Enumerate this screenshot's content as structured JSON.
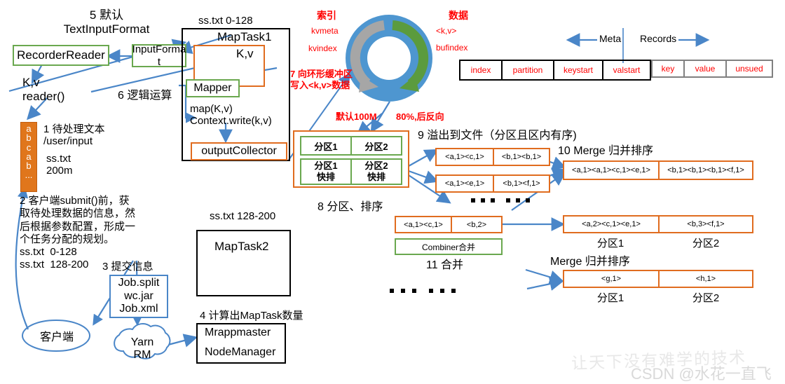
{
  "title": "MapReduce MapTask Shuffle Flow Diagram",
  "labels": {
    "step5": "5 默认\nTextInputFormat",
    "recorder_reader": "RecorderReader",
    "input_format": "InputForma\nt",
    "kv_reader": "K,v\nreader()",
    "step6": "6 逻辑运算",
    "step1": "1 待处理文本\n/user/input",
    "step1b": "ss.txt\n200m",
    "step2": "2 客户端submit()前，获\n取待处理数据的信息，然\n后根据参数配置，形成一\n个任务分配的规划。\nss.txt  0-128\nss.txt  128-200",
    "step3": "3 提交信息",
    "job_box": "Job.split\nwc.jar\nJob.xml",
    "client": "客户端",
    "yarn": "Yarn\nRM",
    "step4": "4 计算出MapTask数量",
    "mrappmaster": "Mrappmaster",
    "nodemanager": "NodeManager",
    "sstxt_0_128": "ss.txt 0-128",
    "maptask1": "MapTask1",
    "kv": "K,v",
    "mapper": "Mapper",
    "map_write": "map(K,v)\nContext.write(k,v)",
    "output_collector": "outputCollector",
    "sstxt_128_200": "ss.txt 128-200",
    "maptask2": "MapTask2",
    "index": "索引",
    "kvmeta": "kvmeta",
    "kvindex": "kvindex",
    "data": "数据",
    "kv_angle": "<k,v>",
    "bufindex": "bufindex",
    "step7": "7 向环形缓冲区\n写入<k,v>数据",
    "default100m": "默认100M",
    "percent80": "80%,后反向",
    "meta": "Meta",
    "records": "Records",
    "step8": "8 分区、排序",
    "step9": "9 溢出到文件（分区且区内有序)",
    "step10": "10 Merge 归并排序",
    "step11": "11 合并",
    "combiner": "Combiner合并",
    "merge_sort": "Merge 归并排序",
    "partition1": "分区1",
    "partition2": "分区2",
    "ellipsis": "• • •   • • •"
  },
  "partition_box": {
    "row1": [
      "分区1",
      "分区2"
    ],
    "row2": [
      "分区1\n快排",
      "分区2\n快排"
    ]
  },
  "meta_table": {
    "meta_cells": [
      "index",
      "partition",
      "keystart",
      "valstart"
    ],
    "record_cells": [
      "key",
      "value",
      "unsued"
    ]
  },
  "spill_files": [
    [
      "<a,1><c,1>",
      "<b,1><b,1>"
    ],
    [
      "<a,1><e,1>",
      "<b,1><f,1>"
    ]
  ],
  "merge_result": [
    "<a,1><a,1><c,1><e,1>",
    "<b,1><b,1><b,1><f,1>"
  ],
  "combine_input": [
    "<a,1><c,1>",
    "<b,2>"
  ],
  "combine_result": [
    "<a,2><c,1><e,1>",
    "<b,3><f,1>"
  ],
  "final_result": [
    "<g,1>",
    "<h,1>"
  ],
  "input_strip": [
    "a",
    "b",
    "c",
    "a",
    "b",
    "..."
  ],
  "watermark": {
    "slogan": "让天下没有难学的技术",
    "credit": "CSDN @水花一直飞"
  },
  "colors": {
    "green": "#6AA84F",
    "orange": "#E06C1F",
    "blue": "#4A86C8",
    "red": "#FF0000",
    "black": "#000000",
    "ring_outer": "#4E96D0",
    "ring_arrow_green": "#5B9B3E",
    "ring_arrow_gray": "#A6A6A6"
  }
}
